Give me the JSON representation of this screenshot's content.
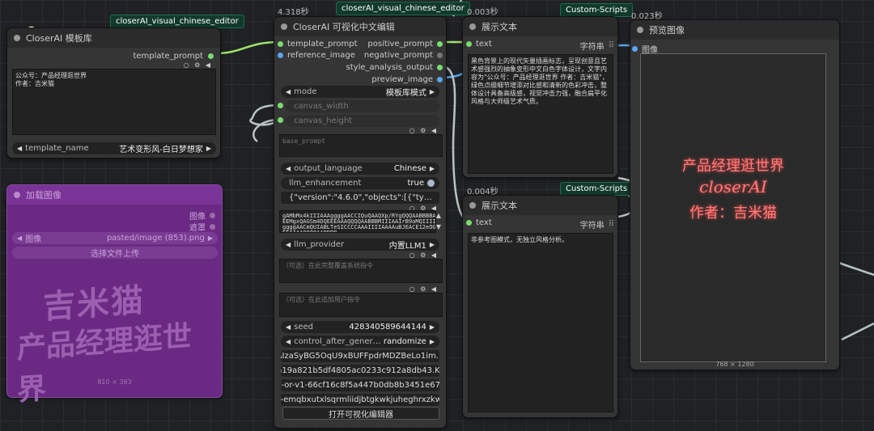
{
  "timers": {
    "editor": "4.318秒",
    "show_text_1": "0.003秒",
    "show_text_2": "0.004秒",
    "preview": "0.023秒"
  },
  "tags": {
    "template_node": "closerAI_visual_chinese_editor",
    "editor_node": "closerAI_visual_chinese_editor",
    "custom_scripts_1": "Custom-Scripts",
    "custom_scripts_2": "Custom-Scripts"
  },
  "template_node": {
    "title": "CloserAI 模板库",
    "output": "template_prompt",
    "text": "公众号：产品经理逛世界\n作者：吉米猫",
    "template_name_label": "template_name",
    "template_name_value": "艺术变形风-白日梦想家"
  },
  "load_image_node": {
    "title": "加载图像",
    "output_image": "图像",
    "output_mask": "遮罩",
    "image_label": "图像",
    "image_value": "pasted/image (853).png",
    "upload_label": "选择文件上传",
    "art_line1": "吉米猫",
    "art_line2": "产品经理逛世界",
    "dims": "810 × 383"
  },
  "editor_node": {
    "title": "CloserAI 可视化中文编辑",
    "inputs": [
      "template_prompt",
      "reference_image"
    ],
    "outputs": [
      "positive_prompt",
      "negative_prompt",
      "style_analysis_output",
      "preview_image"
    ],
    "mode_label": "mode",
    "mode_value": "模板库模式",
    "canvas_width": "canvas_width",
    "canvas_height": "canvas_height",
    "base_prompt_placeholder": "base_prompt",
    "output_language_label": "output_language",
    "output_language_value": "Chinese",
    "llm_enhancement_label": "llm_enhancement",
    "llm_enhancement_value": "true",
    "json_value": "{\"version\":\"4.6.0\",\"objects\":[{\"type\":\"rect\",\"...",
    "base64_text": "gAMbMx4kIIIAAAggggAACCIQuQAAQXp/RYgQQQAABBBBAAAA\nEEMgxQAGSm4DQEEEAAAQQQQAABBBMIIIAAIrB9oMQIIIIAAA\nggggAACmQUIABLTeSICCCCAAAIIIIAAAAuBJEACE12eOGAEE\nEEAAAAQQQQAABBBB",
    "llm_provider_label": "llm_provider",
    "llm_provider_value": "内置LLM1",
    "system_prompt_placeholder": "（可选）在此完整覆盖系统指令",
    "user_prompt_placeholder": "（可选）在此追加用户指令",
    "seed_label": "seed",
    "seed_value": "428340589644144",
    "control_label": "control_after_generate",
    "control_value": "randomize",
    "keys": [
      "AIzaSyBG5OqU9xBUFFpdrMDZBeLo1im...",
      "ca19a821b5df4805ac0233c912a8db43.K...",
      "sk-or-v1-66cf16c8f5a447b0db8b3451e67...",
      "sk-emqbxutxlsqrmliidjbtgkwkjuheghrxzkw..."
    ],
    "open_button": "打开可视化编辑器"
  },
  "show_text_1": {
    "title": "展示文本",
    "input": "text",
    "output": "字符串",
    "content": "黑色背景上的现代矢量插画标志，呈现创意且艺术感强烈的抽象变形中文白色字体设计，文字内容为\"公众号：产品经理逛世界 作者：吉米猫\"，绿色点缀细节增添对比感和清新的色彩冲击，整体设计具备高级感，视觉冲击力强，融合扁平化风格与大师级艺术气质。"
  },
  "show_text_2": {
    "title": "展示文本",
    "input": "text",
    "output": "字符串",
    "content": "非参考图模式，无独立风格分析。"
  },
  "preview_node": {
    "title": "预览图像",
    "input": "图像",
    "line1": "产品经理逛世界",
    "line2": "closerAI",
    "line3": "作者：吉米猫",
    "dims": "768 × 1280"
  },
  "colors": {
    "link_green": "#9fe36a",
    "link_blue": "#5aa6ef",
    "link_grey": "#b9c4c0",
    "purple_node": "#6a2a83",
    "preview_text": "#ff7a7a"
  }
}
